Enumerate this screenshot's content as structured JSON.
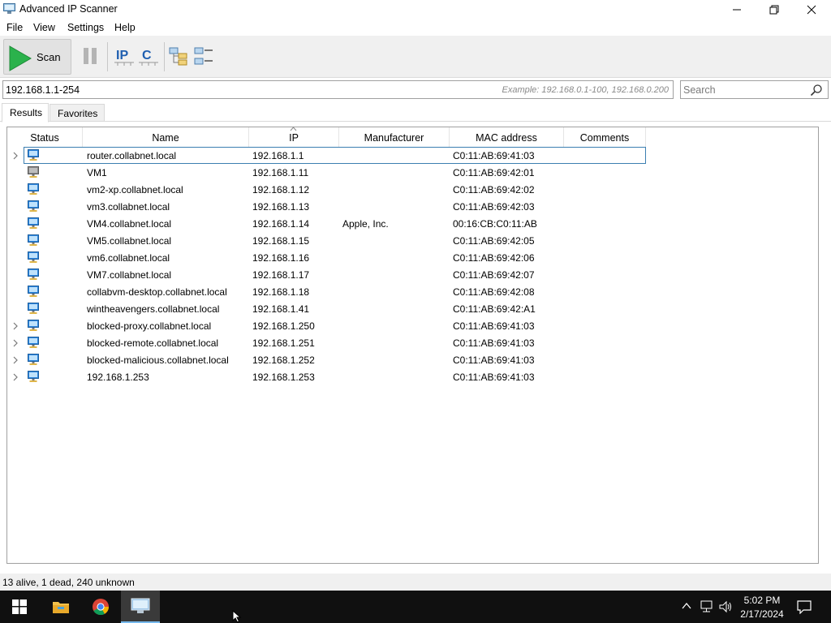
{
  "window": {
    "title": "Advanced IP Scanner"
  },
  "menu": [
    "File",
    "View",
    "Settings",
    "Help"
  ],
  "toolbar": {
    "scan_label": "Scan",
    "ip_label": "IP",
    "c_label": "C"
  },
  "address": {
    "value": "192.168.1.1-254",
    "example": "Example: 192.168.0.1-100, 192.168.0.200"
  },
  "search": {
    "placeholder": "Search"
  },
  "tabs": [
    {
      "label": "Results",
      "active": true
    },
    {
      "label": "Favorites",
      "active": false
    }
  ],
  "columns": [
    "Status",
    "Name",
    "IP",
    "Manufacturer",
    "MAC address",
    "Comments"
  ],
  "rows": [
    {
      "expandable": true,
      "status": "alive",
      "name": "router.collabnet.local",
      "ip": "192.168.1.1",
      "manufacturer": "",
      "mac": "C0:11:AB:69:41:03",
      "comments": "",
      "selected": true
    },
    {
      "expandable": false,
      "status": "dead",
      "name": "VM1",
      "ip": "192.168.1.11",
      "manufacturer": "",
      "mac": "C0:11:AB:69:42:01",
      "comments": ""
    },
    {
      "expandable": false,
      "status": "alive",
      "name": "vm2-xp.collabnet.local",
      "ip": "192.168.1.12",
      "manufacturer": "",
      "mac": "C0:11:AB:69:42:02",
      "comments": ""
    },
    {
      "expandable": false,
      "status": "alive",
      "name": "vm3.collabnet.local",
      "ip": "192.168.1.13",
      "manufacturer": "",
      "mac": "C0:11:AB:69:42:03",
      "comments": ""
    },
    {
      "expandable": false,
      "status": "alive",
      "name": "VM4.collabnet.local",
      "ip": "192.168.1.14",
      "manufacturer": "Apple, Inc.",
      "mac": "00:16:CB:C0:11:AB",
      "comments": ""
    },
    {
      "expandable": false,
      "status": "alive",
      "name": "VM5.collabnet.local",
      "ip": "192.168.1.15",
      "manufacturer": "",
      "mac": "C0:11:AB:69:42:05",
      "comments": ""
    },
    {
      "expandable": false,
      "status": "alive",
      "name": "vm6.collabnet.local",
      "ip": "192.168.1.16",
      "manufacturer": "",
      "mac": "C0:11:AB:69:42:06",
      "comments": ""
    },
    {
      "expandable": false,
      "status": "alive",
      "name": "VM7.collabnet.local",
      "ip": "192.168.1.17",
      "manufacturer": "",
      "mac": "C0:11:AB:69:42:07",
      "comments": ""
    },
    {
      "expandable": false,
      "status": "alive",
      "name": "collabvm-desktop.collabnet.local",
      "ip": "192.168.1.18",
      "manufacturer": "",
      "mac": "C0:11:AB:69:42:08",
      "comments": ""
    },
    {
      "expandable": false,
      "status": "alive",
      "name": "wintheavengers.collabnet.local",
      "ip": "192.168.1.41",
      "manufacturer": "",
      "mac": "C0:11:AB:69:42:A1",
      "comments": ""
    },
    {
      "expandable": true,
      "status": "alive",
      "name": "blocked-proxy.collabnet.local",
      "ip": "192.168.1.250",
      "manufacturer": "",
      "mac": "C0:11:AB:69:41:03",
      "comments": ""
    },
    {
      "expandable": true,
      "status": "alive",
      "name": "blocked-remote.collabnet.local",
      "ip": "192.168.1.251",
      "manufacturer": "",
      "mac": "C0:11:AB:69:41:03",
      "comments": ""
    },
    {
      "expandable": true,
      "status": "alive",
      "name": "blocked-malicious.collabnet.local",
      "ip": "192.168.1.252",
      "manufacturer": "",
      "mac": "C0:11:AB:69:41:03",
      "comments": ""
    },
    {
      "expandable": true,
      "status": "alive",
      "name": "192.168.1.253",
      "ip": "192.168.1.253",
      "manufacturer": "",
      "mac": "C0:11:AB:69:41:03",
      "comments": ""
    }
  ],
  "status_bar": {
    "text": "13 alive, 1 dead, 240 unknown"
  },
  "taskbar": {
    "apps": [
      "start-icon",
      "file-explorer-icon",
      "chrome-icon",
      "advanced-ip-scanner-icon"
    ],
    "time": "5:02 PM",
    "date": "2/17/2024"
  },
  "colors": {
    "accent": "#3c7fb1",
    "alive_monitor": "#2e86de",
    "dead_monitor": "#8a8a8a",
    "scan_green": "#2bb24c",
    "taskbar": "#101010"
  }
}
